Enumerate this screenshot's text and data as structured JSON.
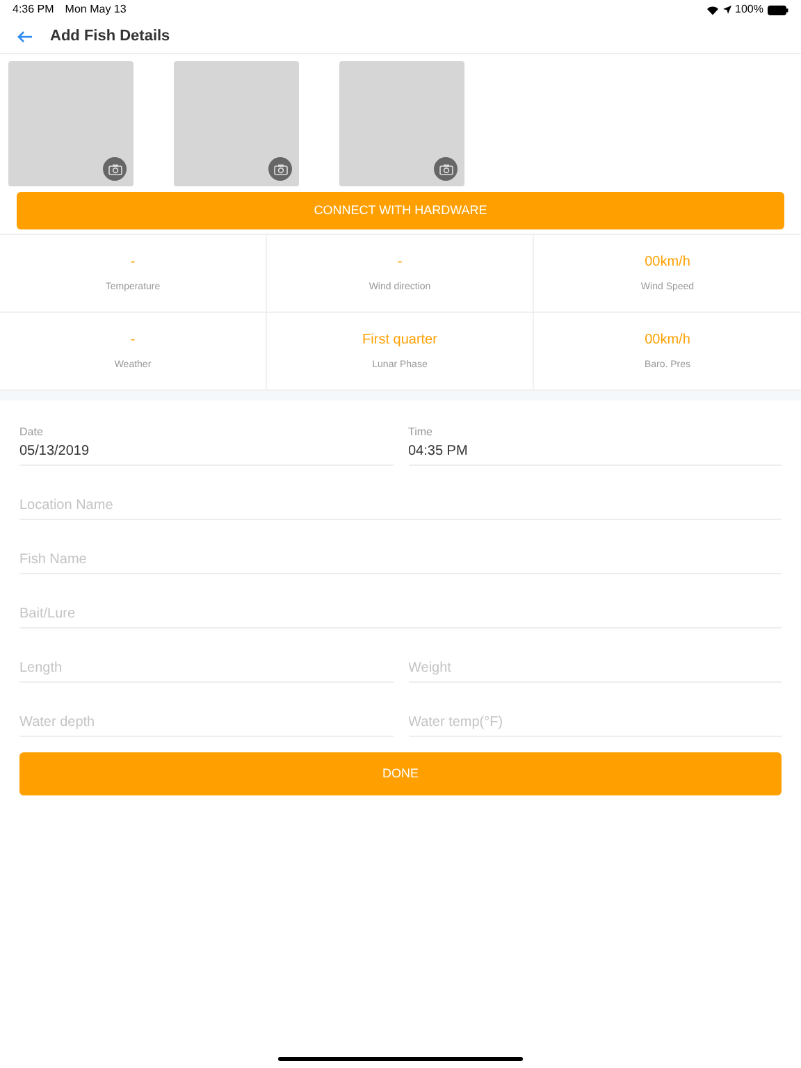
{
  "status_bar": {
    "time": "4:36 PM",
    "date": "Mon May 13",
    "battery": "100%"
  },
  "header": {
    "title": "Add Fish Details"
  },
  "photo_slots": [
    {
      "kind": "empty"
    },
    {
      "kind": "empty"
    },
    {
      "kind": "empty"
    }
  ],
  "connect_button": "CONNECT WITH HARDWARE",
  "readings": [
    {
      "value": "-",
      "label": "Temperature"
    },
    {
      "value": "-",
      "label": "Wind direction"
    },
    {
      "value": "00km/h",
      "label": "Wind Speed"
    },
    {
      "value": "-",
      "label": "Weather"
    },
    {
      "value": "First quarter",
      "label": "Lunar Phase"
    },
    {
      "value": "00km/h",
      "label": "Baro. Pres"
    }
  ],
  "form_rows": [
    [
      {
        "label": "Date",
        "value": "05/13/2019"
      },
      {
        "label": "Time",
        "value": "04:35 PM"
      }
    ],
    [
      {
        "placeholder": "Location Name"
      }
    ],
    [
      {
        "placeholder": "Fish Name"
      }
    ],
    [
      {
        "placeholder": "Bait/Lure"
      }
    ],
    [
      {
        "placeholder": "Length"
      },
      {
        "placeholder": "Weight"
      }
    ],
    [
      {
        "placeholder": "Water depth"
      },
      {
        "placeholder": "Water temp(°F)"
      }
    ]
  ],
  "done_button": "DONE"
}
